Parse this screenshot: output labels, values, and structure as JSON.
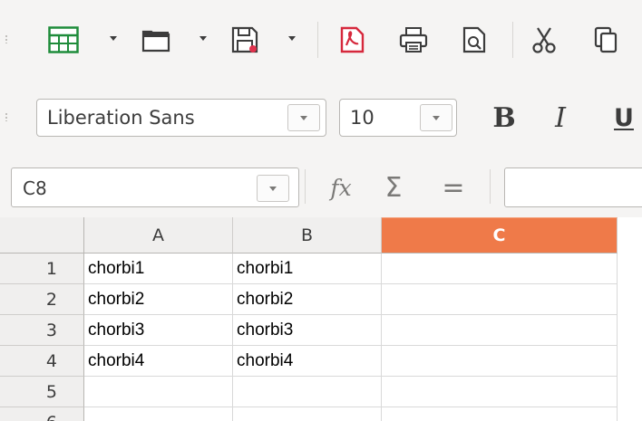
{
  "toolbar": {
    "icons": [
      "table-grid-icon",
      "open-folder-icon",
      "save-icon",
      "export-pdf-icon",
      "print-icon",
      "print-preview-icon",
      "cut-icon",
      "copy-icon"
    ]
  },
  "formatting": {
    "font_name": "Liberation Sans",
    "font_size": "10",
    "bold_label": "B",
    "italic_label": "I",
    "underline_label": "U"
  },
  "formula_bar": {
    "name_box": "C8",
    "function_wizard_label": "fx",
    "sum_label": "Σ",
    "equals_label": "=",
    "formula_value": ""
  },
  "sheet": {
    "columns": [
      {
        "label": "A",
        "selected": false
      },
      {
        "label": "B",
        "selected": false
      },
      {
        "label": "C",
        "selected": true
      }
    ],
    "rows": [
      {
        "label": "1",
        "cells": [
          "chorbi1",
          "chorbi1",
          ""
        ]
      },
      {
        "label": "2",
        "cells": [
          "chorbi2",
          "chorbi2",
          ""
        ]
      },
      {
        "label": "3",
        "cells": [
          "chorbi3",
          "chorbi3",
          ""
        ]
      },
      {
        "label": "4",
        "cells": [
          "chorbi4",
          "chorbi4",
          ""
        ]
      },
      {
        "label": "5",
        "cells": [
          "",
          "",
          ""
        ]
      },
      {
        "label": "6",
        "cells": [
          "",
          "",
          ""
        ]
      }
    ],
    "selected_header_color": "#ef7a49"
  }
}
